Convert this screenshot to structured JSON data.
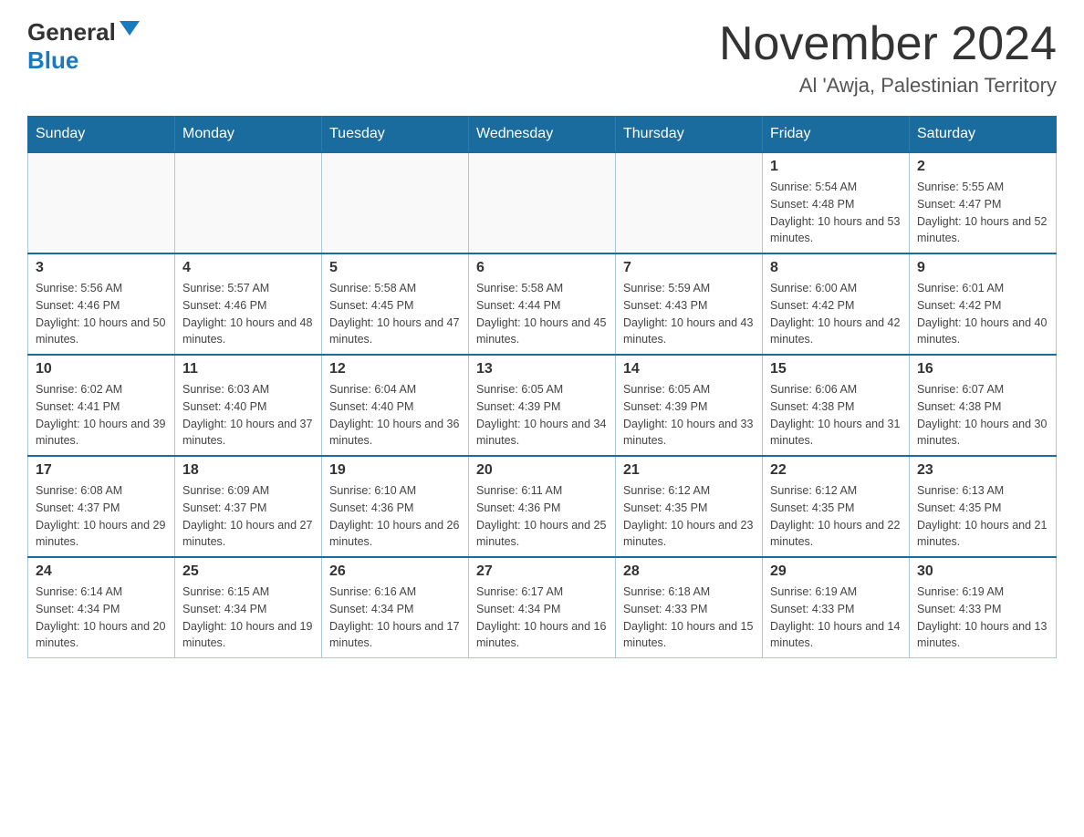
{
  "logo": {
    "general": "General",
    "blue": "Blue"
  },
  "header": {
    "month_year": "November 2024",
    "location": "Al 'Awja, Palestinian Territory"
  },
  "weekdays": [
    "Sunday",
    "Monday",
    "Tuesday",
    "Wednesday",
    "Thursday",
    "Friday",
    "Saturday"
  ],
  "weeks": [
    [
      {
        "day": "",
        "info": ""
      },
      {
        "day": "",
        "info": ""
      },
      {
        "day": "",
        "info": ""
      },
      {
        "day": "",
        "info": ""
      },
      {
        "day": "",
        "info": ""
      },
      {
        "day": "1",
        "info": "Sunrise: 5:54 AM\nSunset: 4:48 PM\nDaylight: 10 hours and 53 minutes."
      },
      {
        "day": "2",
        "info": "Sunrise: 5:55 AM\nSunset: 4:47 PM\nDaylight: 10 hours and 52 minutes."
      }
    ],
    [
      {
        "day": "3",
        "info": "Sunrise: 5:56 AM\nSunset: 4:46 PM\nDaylight: 10 hours and 50 minutes."
      },
      {
        "day": "4",
        "info": "Sunrise: 5:57 AM\nSunset: 4:46 PM\nDaylight: 10 hours and 48 minutes."
      },
      {
        "day": "5",
        "info": "Sunrise: 5:58 AM\nSunset: 4:45 PM\nDaylight: 10 hours and 47 minutes."
      },
      {
        "day": "6",
        "info": "Sunrise: 5:58 AM\nSunset: 4:44 PM\nDaylight: 10 hours and 45 minutes."
      },
      {
        "day": "7",
        "info": "Sunrise: 5:59 AM\nSunset: 4:43 PM\nDaylight: 10 hours and 43 minutes."
      },
      {
        "day": "8",
        "info": "Sunrise: 6:00 AM\nSunset: 4:42 PM\nDaylight: 10 hours and 42 minutes."
      },
      {
        "day": "9",
        "info": "Sunrise: 6:01 AM\nSunset: 4:42 PM\nDaylight: 10 hours and 40 minutes."
      }
    ],
    [
      {
        "day": "10",
        "info": "Sunrise: 6:02 AM\nSunset: 4:41 PM\nDaylight: 10 hours and 39 minutes."
      },
      {
        "day": "11",
        "info": "Sunrise: 6:03 AM\nSunset: 4:40 PM\nDaylight: 10 hours and 37 minutes."
      },
      {
        "day": "12",
        "info": "Sunrise: 6:04 AM\nSunset: 4:40 PM\nDaylight: 10 hours and 36 minutes."
      },
      {
        "day": "13",
        "info": "Sunrise: 6:05 AM\nSunset: 4:39 PM\nDaylight: 10 hours and 34 minutes."
      },
      {
        "day": "14",
        "info": "Sunrise: 6:05 AM\nSunset: 4:39 PM\nDaylight: 10 hours and 33 minutes."
      },
      {
        "day": "15",
        "info": "Sunrise: 6:06 AM\nSunset: 4:38 PM\nDaylight: 10 hours and 31 minutes."
      },
      {
        "day": "16",
        "info": "Sunrise: 6:07 AM\nSunset: 4:38 PM\nDaylight: 10 hours and 30 minutes."
      }
    ],
    [
      {
        "day": "17",
        "info": "Sunrise: 6:08 AM\nSunset: 4:37 PM\nDaylight: 10 hours and 29 minutes."
      },
      {
        "day": "18",
        "info": "Sunrise: 6:09 AM\nSunset: 4:37 PM\nDaylight: 10 hours and 27 minutes."
      },
      {
        "day": "19",
        "info": "Sunrise: 6:10 AM\nSunset: 4:36 PM\nDaylight: 10 hours and 26 minutes."
      },
      {
        "day": "20",
        "info": "Sunrise: 6:11 AM\nSunset: 4:36 PM\nDaylight: 10 hours and 25 minutes."
      },
      {
        "day": "21",
        "info": "Sunrise: 6:12 AM\nSunset: 4:35 PM\nDaylight: 10 hours and 23 minutes."
      },
      {
        "day": "22",
        "info": "Sunrise: 6:12 AM\nSunset: 4:35 PM\nDaylight: 10 hours and 22 minutes."
      },
      {
        "day": "23",
        "info": "Sunrise: 6:13 AM\nSunset: 4:35 PM\nDaylight: 10 hours and 21 minutes."
      }
    ],
    [
      {
        "day": "24",
        "info": "Sunrise: 6:14 AM\nSunset: 4:34 PM\nDaylight: 10 hours and 20 minutes."
      },
      {
        "day": "25",
        "info": "Sunrise: 6:15 AM\nSunset: 4:34 PM\nDaylight: 10 hours and 19 minutes."
      },
      {
        "day": "26",
        "info": "Sunrise: 6:16 AM\nSunset: 4:34 PM\nDaylight: 10 hours and 17 minutes."
      },
      {
        "day": "27",
        "info": "Sunrise: 6:17 AM\nSunset: 4:34 PM\nDaylight: 10 hours and 16 minutes."
      },
      {
        "day": "28",
        "info": "Sunrise: 6:18 AM\nSunset: 4:33 PM\nDaylight: 10 hours and 15 minutes."
      },
      {
        "day": "29",
        "info": "Sunrise: 6:19 AM\nSunset: 4:33 PM\nDaylight: 10 hours and 14 minutes."
      },
      {
        "day": "30",
        "info": "Sunrise: 6:19 AM\nSunset: 4:33 PM\nDaylight: 10 hours and 13 minutes."
      }
    ]
  ]
}
